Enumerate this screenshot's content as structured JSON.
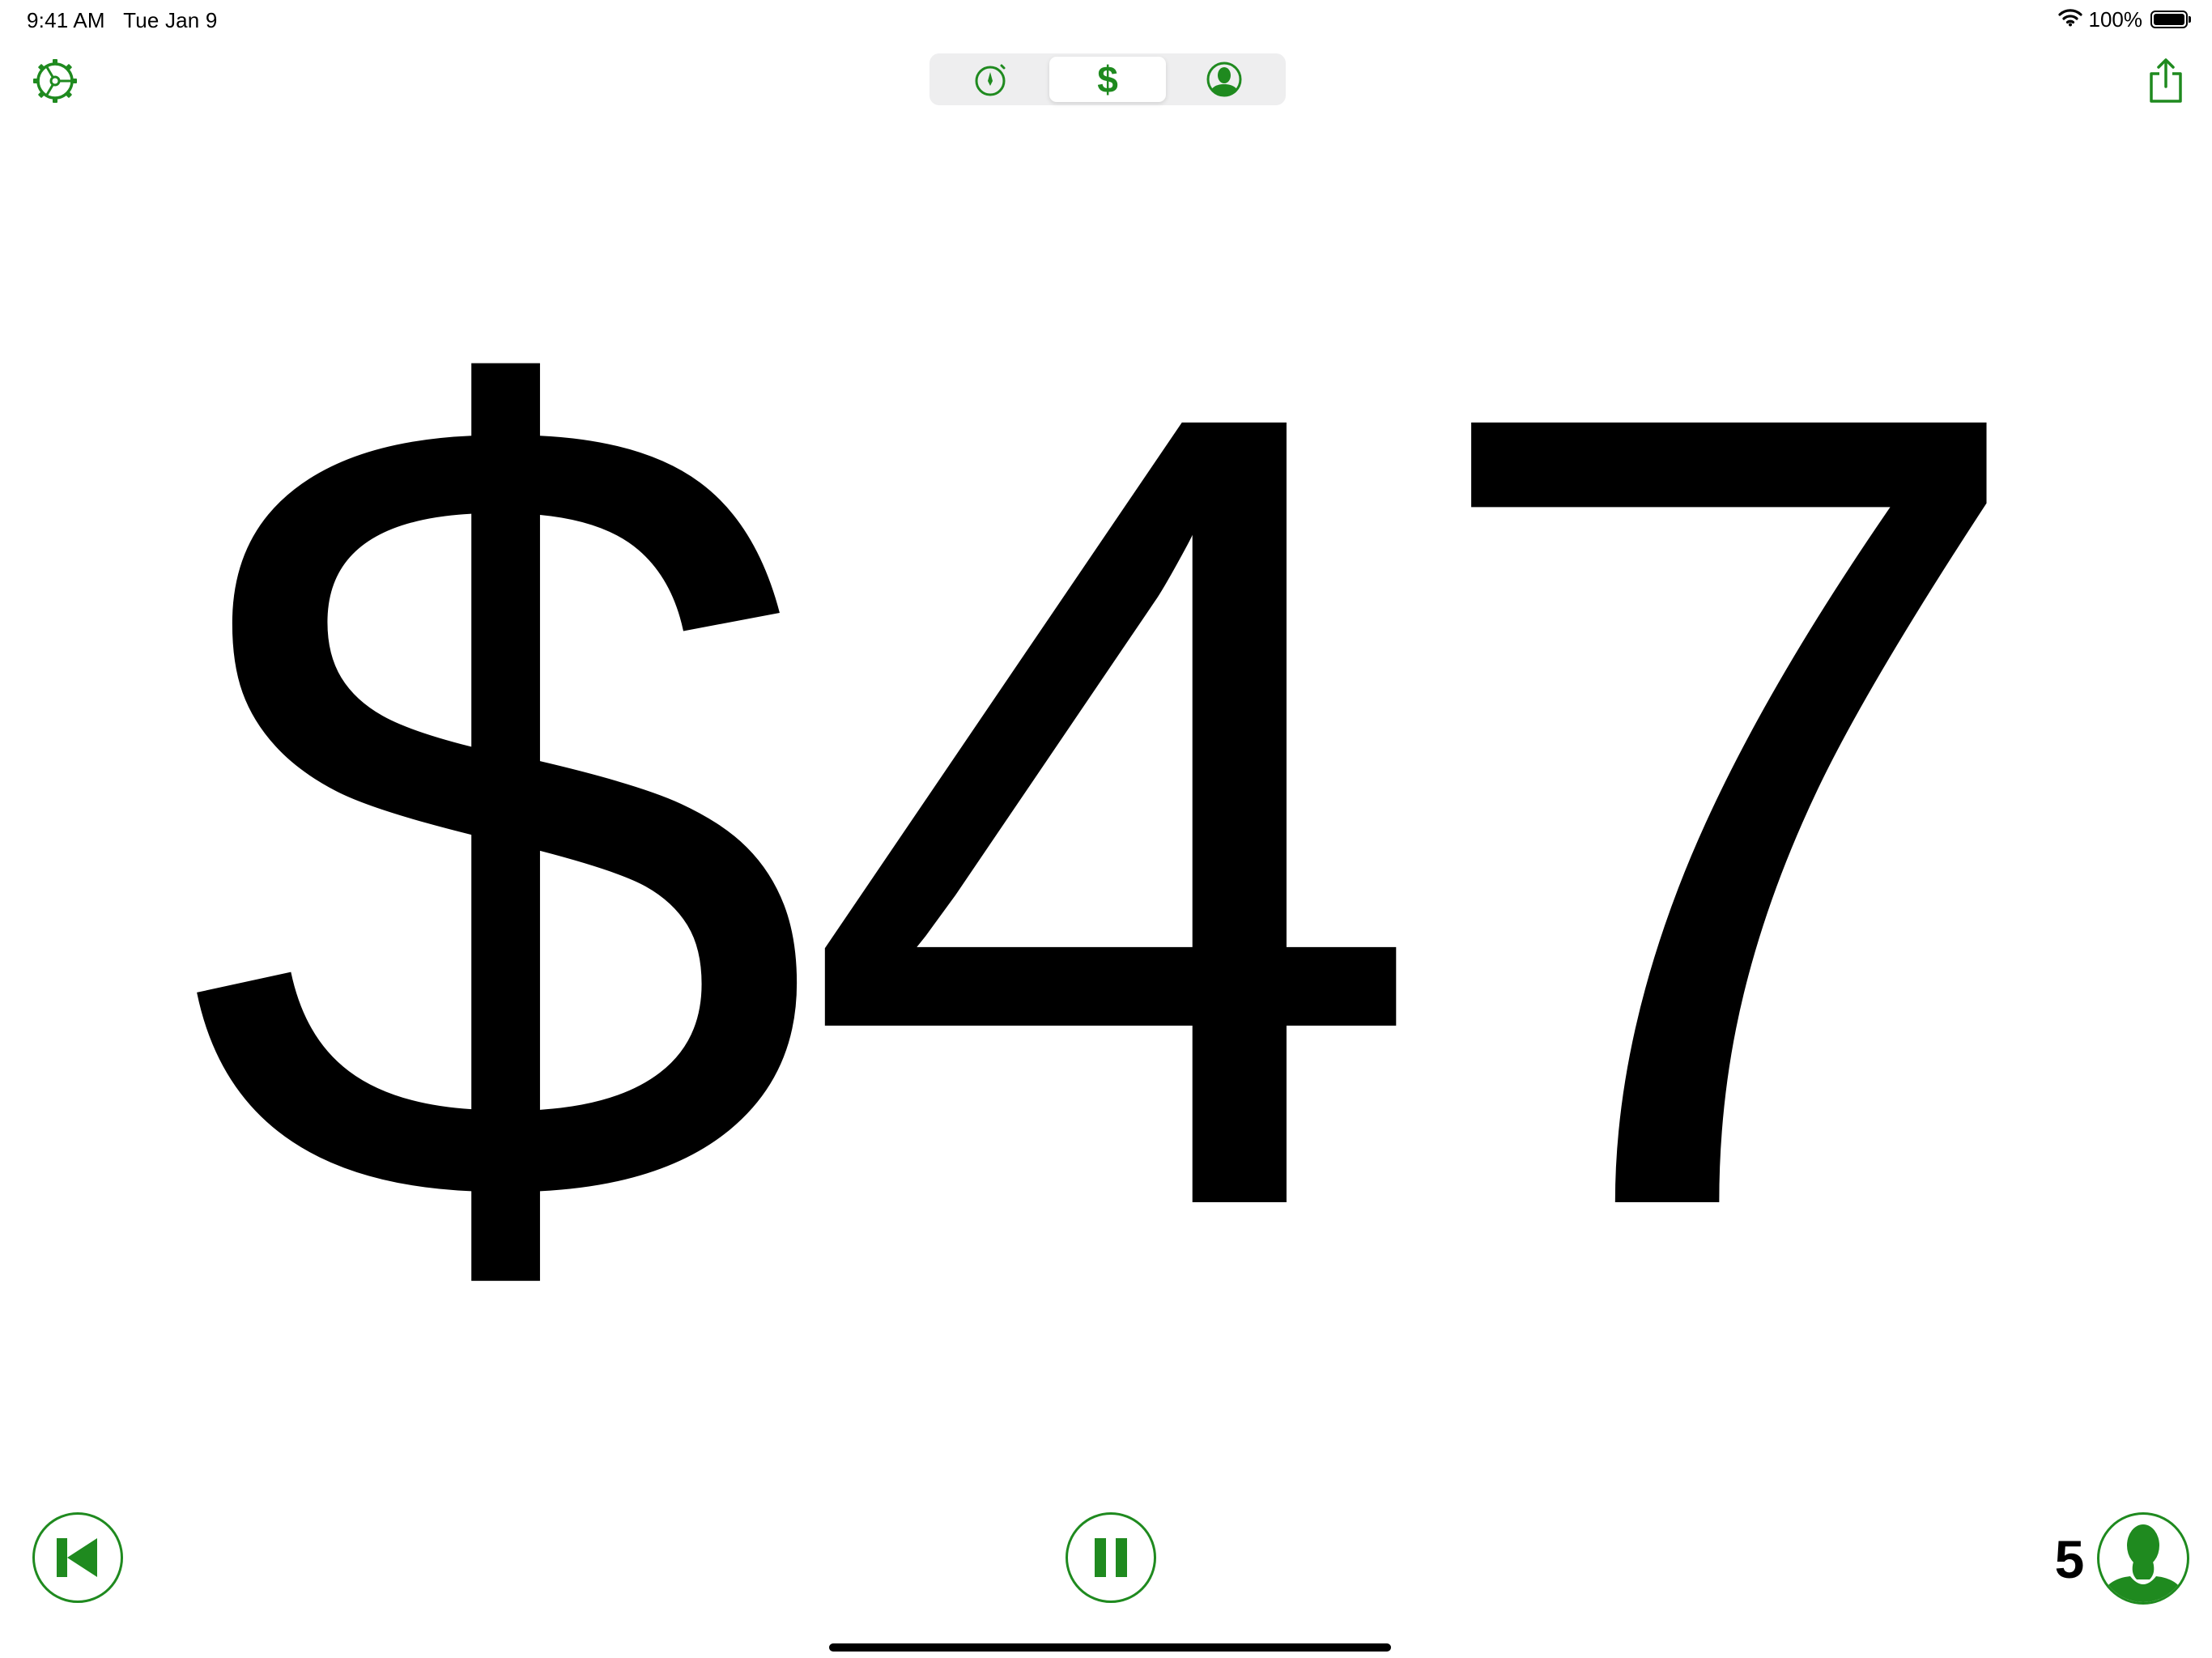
{
  "status_bar": {
    "time": "9:41 AM",
    "date": "Tue Jan 9",
    "battery": "100%",
    "icons": [
      "wifi-icon",
      "battery-icon"
    ]
  },
  "toolbar": {
    "settings_icon": "gear-icon",
    "share_icon": "share-icon",
    "segments": [
      {
        "icon": "timer-icon",
        "selected": false
      },
      {
        "icon": "dollar-icon",
        "glyph": "$",
        "selected": true
      },
      {
        "icon": "person-icon",
        "selected": false
      }
    ]
  },
  "main": {
    "amount": "$47"
  },
  "controls": {
    "rewind_icon": "skip-back-icon",
    "pause_icon": "pause-icon",
    "people_count": "5",
    "people_icon": "person-icon"
  },
  "colors": {
    "accent": "#1f8a1f",
    "segment_bg": "#eeeeef",
    "text": "#000000",
    "background": "#ffffff"
  }
}
